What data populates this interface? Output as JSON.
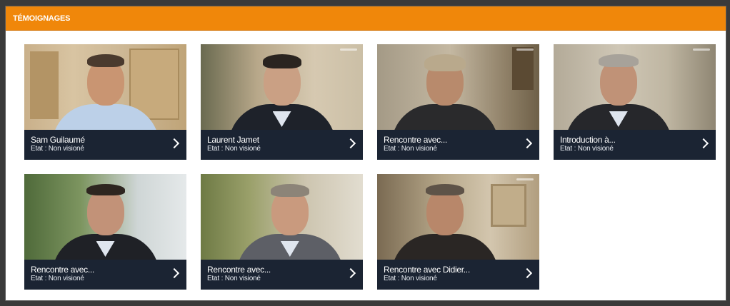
{
  "section": {
    "title": "Témoignages"
  },
  "colors": {
    "header": "#f0870a",
    "caption_bg": "#1b2433"
  },
  "videos": [
    {
      "name": "Sam Guilaumé",
      "state": "Etat : Non visioné",
      "icon": "chevron-right-icon"
    },
    {
      "name": "Laurent Jamet",
      "state": "Etat : Non visioné",
      "icon": "chevron-right-icon"
    },
    {
      "name": "Rencontre avec...",
      "state": "Etat : Non visioné",
      "icon": "chevron-right-icon"
    },
    {
      "name": "Introduction à...",
      "state": "Etat : Non visioné",
      "icon": "chevron-right-icon"
    },
    {
      "name": "Rencontre avec...",
      "state": "Etat : Non visioné",
      "icon": "chevron-right-icon"
    },
    {
      "name": "Rencontre avec...",
      "state": "Etat : Non visioné",
      "icon": "chevron-right-icon"
    },
    {
      "name": "Rencontre avec Didier...",
      "state": "Etat : Non visioné",
      "icon": "chevron-right-icon"
    }
  ]
}
